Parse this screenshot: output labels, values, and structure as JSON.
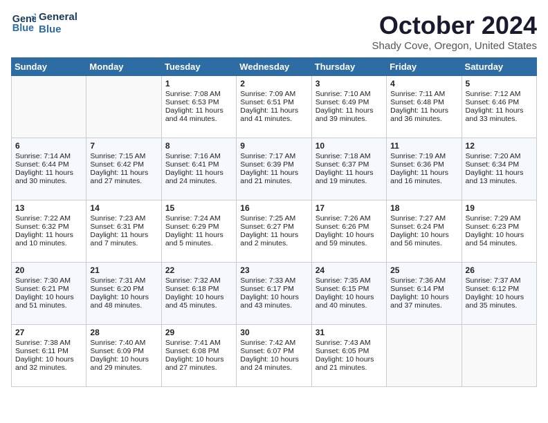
{
  "header": {
    "logo_line1": "General",
    "logo_line2": "Blue",
    "month": "October 2024",
    "location": "Shady Cove, Oregon, United States"
  },
  "days_of_week": [
    "Sunday",
    "Monday",
    "Tuesday",
    "Wednesday",
    "Thursday",
    "Friday",
    "Saturday"
  ],
  "weeks": [
    [
      {
        "day": "",
        "sunrise": "",
        "sunset": "",
        "daylight": "",
        "empty": true
      },
      {
        "day": "",
        "sunrise": "",
        "sunset": "",
        "daylight": "",
        "empty": true
      },
      {
        "day": "1",
        "sunrise": "Sunrise: 7:08 AM",
        "sunset": "Sunset: 6:53 PM",
        "daylight": "Daylight: 11 hours and 44 minutes."
      },
      {
        "day": "2",
        "sunrise": "Sunrise: 7:09 AM",
        "sunset": "Sunset: 6:51 PM",
        "daylight": "Daylight: 11 hours and 41 minutes."
      },
      {
        "day": "3",
        "sunrise": "Sunrise: 7:10 AM",
        "sunset": "Sunset: 6:49 PM",
        "daylight": "Daylight: 11 hours and 39 minutes."
      },
      {
        "day": "4",
        "sunrise": "Sunrise: 7:11 AM",
        "sunset": "Sunset: 6:48 PM",
        "daylight": "Daylight: 11 hours and 36 minutes."
      },
      {
        "day": "5",
        "sunrise": "Sunrise: 7:12 AM",
        "sunset": "Sunset: 6:46 PM",
        "daylight": "Daylight: 11 hours and 33 minutes."
      }
    ],
    [
      {
        "day": "6",
        "sunrise": "Sunrise: 7:14 AM",
        "sunset": "Sunset: 6:44 PM",
        "daylight": "Daylight: 11 hours and 30 minutes."
      },
      {
        "day": "7",
        "sunrise": "Sunrise: 7:15 AM",
        "sunset": "Sunset: 6:42 PM",
        "daylight": "Daylight: 11 hours and 27 minutes."
      },
      {
        "day": "8",
        "sunrise": "Sunrise: 7:16 AM",
        "sunset": "Sunset: 6:41 PM",
        "daylight": "Daylight: 11 hours and 24 minutes."
      },
      {
        "day": "9",
        "sunrise": "Sunrise: 7:17 AM",
        "sunset": "Sunset: 6:39 PM",
        "daylight": "Daylight: 11 hours and 21 minutes."
      },
      {
        "day": "10",
        "sunrise": "Sunrise: 7:18 AM",
        "sunset": "Sunset: 6:37 PM",
        "daylight": "Daylight: 11 hours and 19 minutes."
      },
      {
        "day": "11",
        "sunrise": "Sunrise: 7:19 AM",
        "sunset": "Sunset: 6:36 PM",
        "daylight": "Daylight: 11 hours and 16 minutes."
      },
      {
        "day": "12",
        "sunrise": "Sunrise: 7:20 AM",
        "sunset": "Sunset: 6:34 PM",
        "daylight": "Daylight: 11 hours and 13 minutes."
      }
    ],
    [
      {
        "day": "13",
        "sunrise": "Sunrise: 7:22 AM",
        "sunset": "Sunset: 6:32 PM",
        "daylight": "Daylight: 11 hours and 10 minutes."
      },
      {
        "day": "14",
        "sunrise": "Sunrise: 7:23 AM",
        "sunset": "Sunset: 6:31 PM",
        "daylight": "Daylight: 11 hours and 7 minutes."
      },
      {
        "day": "15",
        "sunrise": "Sunrise: 7:24 AM",
        "sunset": "Sunset: 6:29 PM",
        "daylight": "Daylight: 11 hours and 5 minutes."
      },
      {
        "day": "16",
        "sunrise": "Sunrise: 7:25 AM",
        "sunset": "Sunset: 6:27 PM",
        "daylight": "Daylight: 11 hours and 2 minutes."
      },
      {
        "day": "17",
        "sunrise": "Sunrise: 7:26 AM",
        "sunset": "Sunset: 6:26 PM",
        "daylight": "Daylight: 10 hours and 59 minutes."
      },
      {
        "day": "18",
        "sunrise": "Sunrise: 7:27 AM",
        "sunset": "Sunset: 6:24 PM",
        "daylight": "Daylight: 10 hours and 56 minutes."
      },
      {
        "day": "19",
        "sunrise": "Sunrise: 7:29 AM",
        "sunset": "Sunset: 6:23 PM",
        "daylight": "Daylight: 10 hours and 54 minutes."
      }
    ],
    [
      {
        "day": "20",
        "sunrise": "Sunrise: 7:30 AM",
        "sunset": "Sunset: 6:21 PM",
        "daylight": "Daylight: 10 hours and 51 minutes."
      },
      {
        "day": "21",
        "sunrise": "Sunrise: 7:31 AM",
        "sunset": "Sunset: 6:20 PM",
        "daylight": "Daylight: 10 hours and 48 minutes."
      },
      {
        "day": "22",
        "sunrise": "Sunrise: 7:32 AM",
        "sunset": "Sunset: 6:18 PM",
        "daylight": "Daylight: 10 hours and 45 minutes."
      },
      {
        "day": "23",
        "sunrise": "Sunrise: 7:33 AM",
        "sunset": "Sunset: 6:17 PM",
        "daylight": "Daylight: 10 hours and 43 minutes."
      },
      {
        "day": "24",
        "sunrise": "Sunrise: 7:35 AM",
        "sunset": "Sunset: 6:15 PM",
        "daylight": "Daylight: 10 hours and 40 minutes."
      },
      {
        "day": "25",
        "sunrise": "Sunrise: 7:36 AM",
        "sunset": "Sunset: 6:14 PM",
        "daylight": "Daylight: 10 hours and 37 minutes."
      },
      {
        "day": "26",
        "sunrise": "Sunrise: 7:37 AM",
        "sunset": "Sunset: 6:12 PM",
        "daylight": "Daylight: 10 hours and 35 minutes."
      }
    ],
    [
      {
        "day": "27",
        "sunrise": "Sunrise: 7:38 AM",
        "sunset": "Sunset: 6:11 PM",
        "daylight": "Daylight: 10 hours and 32 minutes."
      },
      {
        "day": "28",
        "sunrise": "Sunrise: 7:40 AM",
        "sunset": "Sunset: 6:09 PM",
        "daylight": "Daylight: 10 hours and 29 minutes."
      },
      {
        "day": "29",
        "sunrise": "Sunrise: 7:41 AM",
        "sunset": "Sunset: 6:08 PM",
        "daylight": "Daylight: 10 hours and 27 minutes."
      },
      {
        "day": "30",
        "sunrise": "Sunrise: 7:42 AM",
        "sunset": "Sunset: 6:07 PM",
        "daylight": "Daylight: 10 hours and 24 minutes."
      },
      {
        "day": "31",
        "sunrise": "Sunrise: 7:43 AM",
        "sunset": "Sunset: 6:05 PM",
        "daylight": "Daylight: 10 hours and 21 minutes."
      },
      {
        "day": "",
        "sunrise": "",
        "sunset": "",
        "daylight": "",
        "empty": true
      },
      {
        "day": "",
        "sunrise": "",
        "sunset": "",
        "daylight": "",
        "empty": true
      }
    ]
  ]
}
